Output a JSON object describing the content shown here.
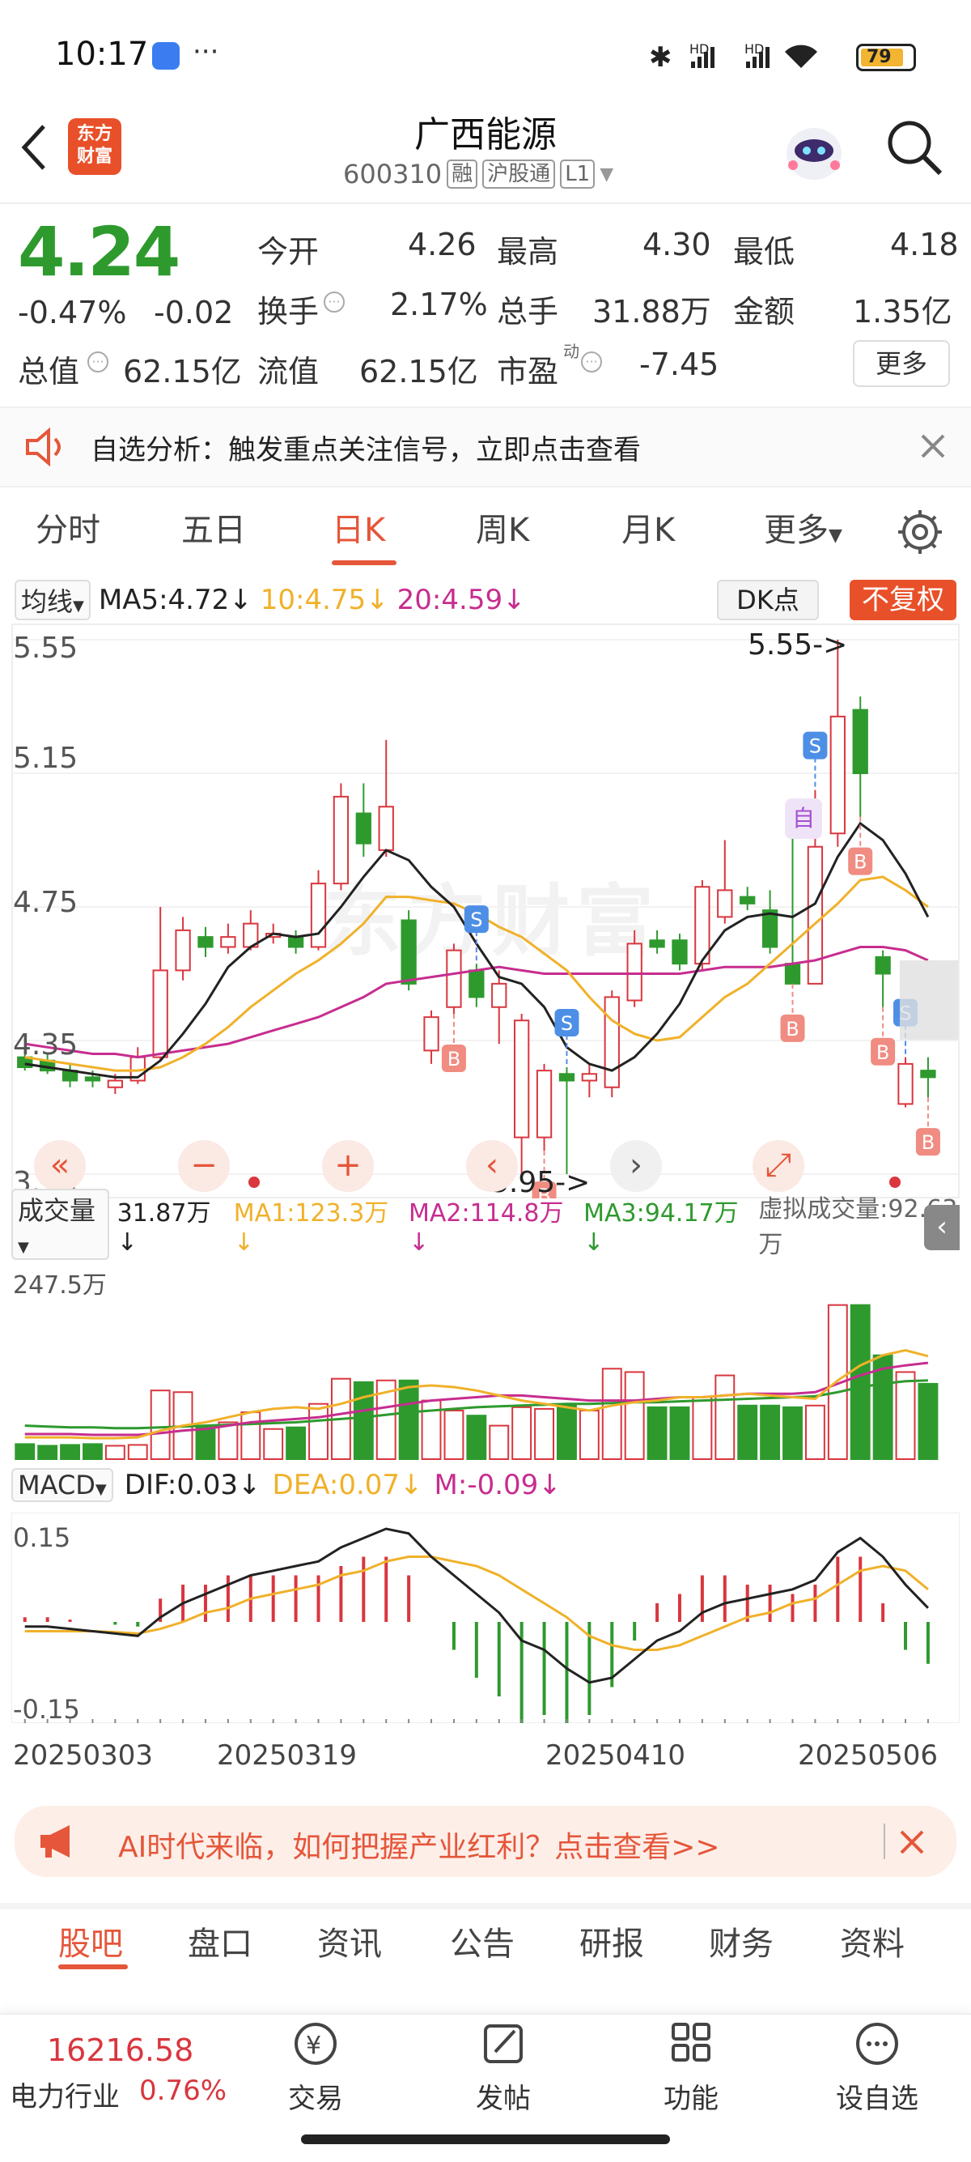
{
  "status_bar": {
    "time": "10:17",
    "battery": "79"
  },
  "header": {
    "logo_line1": "东方",
    "logo_line2": "财富",
    "stock_name": "广西能源",
    "stock_code": "600310",
    "tag_rong": "融",
    "tag_hgt": "沪股通",
    "tag_level": "L1"
  },
  "quote": {
    "price": "4.24",
    "change_pct": "-0.47%",
    "change_amt": "-0.02",
    "open_label": "今开",
    "open": "4.26",
    "high_label": "最高",
    "high": "4.30",
    "low_label": "最低",
    "low": "4.18",
    "turnover_label": "换手",
    "turnover": "2.17%",
    "volume_label": "总手",
    "volume": "31.88万",
    "amount_label": "金额",
    "amount": "1.35亿",
    "mktcap_label": "总值",
    "mktcap": "62.15亿",
    "float_label": "流值",
    "float_cap": "62.15亿",
    "pe_label": "市盈",
    "pe_sup": "动",
    "pe": "-7.45",
    "more": "更多"
  },
  "notice": {
    "text": "自选分析：触发重点关注信号，立即点击查看"
  },
  "tabs": [
    "分时",
    "五日",
    "日K",
    "周K",
    "月K",
    "更多"
  ],
  "ma": {
    "dropdown": "均线",
    "ma5": "MA5:4.72↓",
    "ma10": "10:4.75↓",
    "ma20": "20:4.59↓",
    "dk": "DK点",
    "fq": "不复权"
  },
  "kline": {
    "y_ticks": [
      "5.55",
      "5.15",
      "4.75",
      "4.35",
      "3.95"
    ],
    "max_label": "5.55->",
    "min_label": "3.95->",
    "watermark": "东方财富",
    "marker_self": "自"
  },
  "volume": {
    "dropdown": "成交量",
    "vol": "31.87万↓",
    "ma1": "MA1:123.3万↓",
    "ma2": "MA2:114.8万↓",
    "ma3": "MA3:94.17万↓",
    "virtual": "虚拟成交量:92.63万",
    "top": "247.5万"
  },
  "macd": {
    "dropdown": "MACD",
    "dif": "DIF:0.03↓",
    "dea": "DEA:0.07↓",
    "m": "M:-0.09↓",
    "top": "0.15",
    "bottom": "-0.15"
  },
  "dates": [
    "20250303",
    "20250319",
    "20250410",
    "20250506"
  ],
  "ad": {
    "text": "AI时代来临，如何把握产业红利？点击查看>>"
  },
  "bottom_tabs": [
    "股吧",
    "盘口",
    "资讯",
    "公告",
    "研报",
    "财务",
    "资料"
  ],
  "footer": {
    "index": "16216.58",
    "industry": "电力行业",
    "industry_change": "0.76%",
    "trade": "交易",
    "post": "发帖",
    "func": "功能",
    "watchlist": "设自选"
  },
  "colors": {
    "up": "#d9363e",
    "down": "#2e9a2e",
    "accent": "#e5563a"
  },
  "chart_data": {
    "type": "candlestick",
    "y_range": [
      3.95,
      5.55
    ],
    "candles": [
      {
        "o": 4.3,
        "c": 4.27,
        "h": 4.33,
        "l": 4.26
      },
      {
        "o": 4.29,
        "c": 4.26,
        "h": 4.31,
        "l": 4.25
      },
      {
        "o": 4.26,
        "c": 4.23,
        "h": 4.28,
        "l": 4.21
      },
      {
        "o": 4.24,
        "c": 4.23,
        "h": 4.26,
        "l": 4.21
      },
      {
        "o": 4.21,
        "c": 4.23,
        "h": 4.25,
        "l": 4.19
      },
      {
        "o": 4.23,
        "c": 4.3,
        "h": 4.33,
        "l": 4.22
      },
      {
        "o": 4.3,
        "c": 4.56,
        "h": 4.75,
        "l": 4.29
      },
      {
        "o": 4.56,
        "c": 4.68,
        "h": 4.72,
        "l": 4.53
      },
      {
        "o": 4.66,
        "c": 4.63,
        "h": 4.69,
        "l": 4.6
      },
      {
        "o": 4.63,
        "c": 4.66,
        "h": 4.7,
        "l": 4.61
      },
      {
        "o": 4.63,
        "c": 4.7,
        "h": 4.74,
        "l": 4.62
      },
      {
        "o": 4.66,
        "c": 4.67,
        "h": 4.7,
        "l": 4.64
      },
      {
        "o": 4.66,
        "c": 4.63,
        "h": 4.68,
        "l": 4.61
      },
      {
        "o": 4.63,
        "c": 4.82,
        "h": 4.86,
        "l": 4.62
      },
      {
        "o": 4.82,
        "c": 5.08,
        "h": 5.12,
        "l": 4.8
      },
      {
        "o": 5.03,
        "c": 4.94,
        "h": 5.12,
        "l": 4.9
      },
      {
        "o": 4.92,
        "c": 5.05,
        "h": 5.25,
        "l": 4.9
      },
      {
        "o": 4.71,
        "c": 4.52,
        "h": 4.74,
        "l": 4.5
      },
      {
        "o": 4.32,
        "c": 4.42,
        "h": 4.44,
        "l": 4.28
      },
      {
        "o": 4.45,
        "c": 4.62,
        "h": 4.64,
        "l": 4.43
      },
      {
        "o": 4.56,
        "c": 4.48,
        "h": 4.58,
        "l": 4.45
      },
      {
        "o": 4.45,
        "c": 4.52,
        "h": 4.56,
        "l": 4.34
      },
      {
        "o": 4.06,
        "c": 4.41,
        "h": 4.43,
        "l": 3.95
      },
      {
        "o": 4.06,
        "c": 4.26,
        "h": 4.28,
        "l": 4.02
      },
      {
        "o": 4.25,
        "c": 4.23,
        "h": 4.27,
        "l": 3.95
      },
      {
        "o": 4.23,
        "c": 4.25,
        "h": 4.28,
        "l": 4.18
      },
      {
        "o": 4.21,
        "c": 4.48,
        "h": 4.5,
        "l": 4.18
      },
      {
        "o": 4.47,
        "c": 4.64,
        "h": 4.68,
        "l": 4.45
      },
      {
        "o": 4.65,
        "c": 4.63,
        "h": 4.68,
        "l": 4.61
      },
      {
        "o": 4.65,
        "c": 4.58,
        "h": 4.67,
        "l": 4.56
      },
      {
        "o": 4.58,
        "c": 4.81,
        "h": 4.83,
        "l": 4.56
      },
      {
        "o": 4.72,
        "c": 4.8,
        "h": 4.95,
        "l": 4.7
      },
      {
        "o": 4.78,
        "c": 4.76,
        "h": 4.81,
        "l": 4.74
      },
      {
        "o": 4.74,
        "c": 4.63,
        "h": 4.8,
        "l": 4.61
      },
      {
        "o": 4.58,
        "c": 4.52,
        "h": 4.97,
        "l": 4.52
      },
      {
        "o": 4.52,
        "c": 4.93,
        "h": 5.1,
        "l": 4.52
      },
      {
        "o": 4.97,
        "c": 5.32,
        "h": 5.55,
        "l": 4.93
      },
      {
        "o": 5.34,
        "c": 5.15,
        "h": 5.38,
        "l": 5.02
      },
      {
        "o": 4.6,
        "c": 4.55,
        "h": 4.62,
        "l": 4.45
      },
      {
        "o": 4.16,
        "c": 4.28,
        "h": 4.3,
        "l": 4.15
      },
      {
        "o": 4.26,
        "c": 4.24,
        "h": 4.3,
        "l": 4.18
      }
    ],
    "ma5": [
      4.28,
      4.27,
      4.26,
      4.25,
      4.24,
      4.24,
      4.29,
      4.37,
      4.46,
      4.57,
      4.63,
      4.67,
      4.66,
      4.67,
      4.75,
      4.84,
      4.92,
      4.89,
      4.81,
      4.75,
      4.64,
      4.54,
      4.52,
      4.45,
      4.33,
      4.28,
      4.26,
      4.3,
      4.37,
      4.46,
      4.59,
      4.68,
      4.72,
      4.73,
      4.72,
      4.76,
      4.9,
      5.0,
      4.95,
      4.85,
      4.72
    ],
    "ma10": [
      4.3,
      4.29,
      4.28,
      4.27,
      4.26,
      4.26,
      4.27,
      4.3,
      4.34,
      4.39,
      4.45,
      4.5,
      4.55,
      4.59,
      4.64,
      4.7,
      4.78,
      4.78,
      4.77,
      4.76,
      4.73,
      4.69,
      4.66,
      4.61,
      4.56,
      4.48,
      4.41,
      4.37,
      4.35,
      4.36,
      4.42,
      4.48,
      4.52,
      4.58,
      4.64,
      4.7,
      4.76,
      4.83,
      4.84,
      4.8,
      4.75
    ],
    "ma20": [
      4.34,
      4.33,
      4.32,
      4.31,
      4.31,
      4.3,
      4.31,
      4.32,
      4.33,
      4.34,
      4.36,
      4.38,
      4.4,
      4.42,
      4.45,
      4.48,
      4.52,
      4.53,
      4.54,
      4.55,
      4.56,
      4.57,
      4.56,
      4.55,
      4.55,
      4.55,
      4.55,
      4.55,
      4.55,
      4.55,
      4.56,
      4.57,
      4.57,
      4.57,
      4.58,
      4.59,
      4.61,
      4.63,
      4.63,
      4.62,
      4.59
    ],
    "volume": {
      "max": 247.5,
      "values": [
        18,
        16,
        17,
        18,
        16,
        17,
        82,
        80,
        38,
        44,
        56,
        36,
        38,
        66,
        96,
        92,
        94,
        94,
        70,
        58,
        52,
        40,
        62,
        60,
        64,
        58,
        108,
        104,
        62,
        62,
        74,
        100,
        64,
        64,
        62,
        64,
        184,
        184,
        124,
        104,
        90
      ],
      "ma1": [
        26,
        26,
        26,
        25,
        25,
        26,
        34,
        40,
        44,
        50,
        56,
        60,
        62,
        60,
        66,
        74,
        80,
        86,
        88,
        86,
        82,
        76,
        70,
        66,
        62,
        58,
        64,
        68,
        70,
        74,
        74,
        76,
        78,
        76,
        74,
        72,
        94,
        112,
        124,
        130,
        123
      ],
      "ma2": [
        30,
        30,
        30,
        29,
        29,
        29,
        31,
        34,
        36,
        40,
        44,
        46,
        48,
        50,
        54,
        58,
        62,
        66,
        70,
        72,
        74,
        76,
        76,
        74,
        72,
        70,
        70,
        70,
        72,
        74,
        74,
        76,
        78,
        78,
        78,
        80,
        90,
        100,
        108,
        112,
        115
      ],
      "ma3": [
        40,
        39,
        38,
        38,
        37,
        37,
        38,
        39,
        40,
        41,
        42,
        43,
        44,
        46,
        48,
        50,
        53,
        56,
        58,
        60,
        62,
        63,
        64,
        65,
        66,
        66,
        67,
        68,
        68,
        69,
        70,
        71,
        72,
        73,
        74,
        75,
        80,
        86,
        90,
        93,
        94
      ]
    },
    "macd": {
      "dif": [
        -0.01,
        -0.01,
        -0.015,
        -0.02,
        -0.025,
        -0.03,
        0.01,
        0.04,
        0.06,
        0.08,
        0.1,
        0.11,
        0.12,
        0.13,
        0.16,
        0.18,
        0.2,
        0.19,
        0.14,
        0.1,
        0.06,
        0.02,
        -0.04,
        -0.06,
        -0.1,
        -0.13,
        -0.12,
        -0.08,
        -0.04,
        -0.02,
        0.02,
        0.04,
        0.05,
        0.06,
        0.07,
        0.09,
        0.15,
        0.18,
        0.14,
        0.08,
        0.03
      ],
      "dea": [
        -0.02,
        -0.02,
        -0.02,
        -0.02,
        -0.022,
        -0.025,
        -0.015,
        0.0,
        0.02,
        0.03,
        0.05,
        0.06,
        0.07,
        0.08,
        0.1,
        0.11,
        0.13,
        0.14,
        0.14,
        0.13,
        0.12,
        0.1,
        0.07,
        0.04,
        0.01,
        -0.03,
        -0.05,
        -0.06,
        -0.06,
        -0.05,
        -0.03,
        -0.01,
        0.01,
        0.02,
        0.04,
        0.05,
        0.08,
        0.11,
        0.12,
        0.11,
        0.07
      ],
      "m": [
        0.01,
        0.01,
        0.005,
        0.0,
        -0.006,
        -0.01,
        0.05,
        0.08,
        0.08,
        0.1,
        0.1,
        0.1,
        0.1,
        0.1,
        0.12,
        0.14,
        0.14,
        0.1,
        0.0,
        -0.06,
        -0.12,
        -0.16,
        -0.22,
        -0.2,
        -0.22,
        -0.2,
        -0.14,
        -0.04,
        0.04,
        0.06,
        0.1,
        0.1,
        0.08,
        0.08,
        0.06,
        0.08,
        0.14,
        0.14,
        0.04,
        -0.06,
        -0.09
      ]
    }
  }
}
